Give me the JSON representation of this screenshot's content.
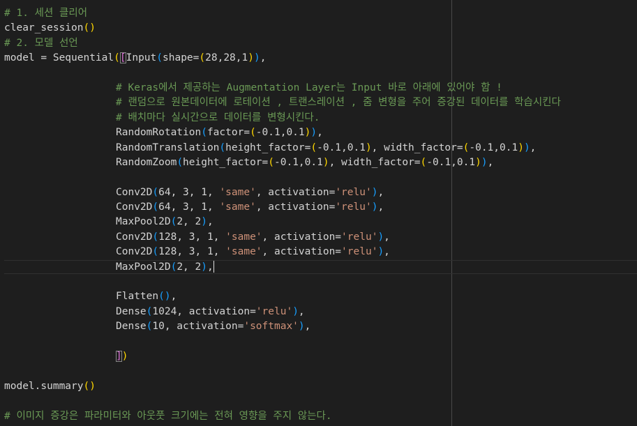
{
  "editor": {
    "theme_colors": {
      "background": "#1e1e1e",
      "text": "#d4d4d4",
      "comment": "#6a9955",
      "string": "#ce9178",
      "bracket_level_1": "#ffd700",
      "bracket_level_2": "#da70d6",
      "bracket_level_3": "#179fff"
    },
    "lines": [
      [
        {
          "t": "# 1. 세션 클리어",
          "k": "comment"
        }
      ],
      [
        {
          "t": "clear_session",
          "k": "default"
        },
        {
          "t": "()",
          "k": "b1"
        }
      ],
      [
        {
          "t": "# 2. 모델 선언",
          "k": "comment"
        }
      ],
      [
        {
          "t": "model = Sequential",
          "k": "default"
        },
        {
          "t": "(",
          "k": "b1"
        },
        {
          "t": "[",
          "k": "b2",
          "m": 1
        },
        {
          "t": "Input",
          "k": "default"
        },
        {
          "t": "(",
          "k": "b3"
        },
        {
          "t": "shape=",
          "k": "default"
        },
        {
          "t": "(",
          "k": "b1"
        },
        {
          "t": "28,28,1",
          "k": "default"
        },
        {
          "t": ")",
          "k": "b1"
        },
        {
          "t": ")",
          "k": "b3"
        },
        {
          "t": ",",
          "k": "default"
        }
      ],
      [],
      [
        {
          "t": "# Keras에서 제공하는 Augmentation Layer는 Input 바로 아래에 있어야 함 !",
          "k": "comment"
        }
      ],
      [
        {
          "t": "# 랜덤으로 원본데이터에 로테이션 , 트랜스레이션 , 줌 변형을 주어 증강된 데이터를 학습시킨다",
          "k": "comment"
        }
      ],
      [
        {
          "t": "# 배치마다 실시간으로 데이터를 변형시킨다.",
          "k": "comment"
        }
      ],
      [
        {
          "t": "RandomRotation",
          "k": "default"
        },
        {
          "t": "(",
          "k": "b3"
        },
        {
          "t": "factor=",
          "k": "default"
        },
        {
          "t": "(",
          "k": "b1"
        },
        {
          "t": "-0.1,0.1",
          "k": "default"
        },
        {
          "t": ")",
          "k": "b1"
        },
        {
          "t": ")",
          "k": "b3"
        },
        {
          "t": ",",
          "k": "default"
        }
      ],
      [
        {
          "t": "RandomTranslation",
          "k": "default"
        },
        {
          "t": "(",
          "k": "b3"
        },
        {
          "t": "height_factor=",
          "k": "default"
        },
        {
          "t": "(",
          "k": "b1"
        },
        {
          "t": "-0.1,0.1",
          "k": "default"
        },
        {
          "t": ")",
          "k": "b1"
        },
        {
          "t": ", width_factor=",
          "k": "default"
        },
        {
          "t": "(",
          "k": "b1"
        },
        {
          "t": "-0.1,0.1",
          "k": "default"
        },
        {
          "t": ")",
          "k": "b1"
        },
        {
          "t": ")",
          "k": "b3"
        },
        {
          "t": ",",
          "k": "default"
        }
      ],
      [
        {
          "t": "RandomZoom",
          "k": "default"
        },
        {
          "t": "(",
          "k": "b3"
        },
        {
          "t": "height_factor=",
          "k": "default"
        },
        {
          "t": "(",
          "k": "b1"
        },
        {
          "t": "-0.1,0.1",
          "k": "default"
        },
        {
          "t": ")",
          "k": "b1"
        },
        {
          "t": ", width_factor=",
          "k": "default"
        },
        {
          "t": "(",
          "k": "b1"
        },
        {
          "t": "-0.1,0.1",
          "k": "default"
        },
        {
          "t": ")",
          "k": "b1"
        },
        {
          "t": ")",
          "k": "b3"
        },
        {
          "t": ",",
          "k": "default"
        }
      ],
      [],
      [
        {
          "t": "Conv2D",
          "k": "default"
        },
        {
          "t": "(",
          "k": "b3"
        },
        {
          "t": "64, 3, 1, ",
          "k": "default"
        },
        {
          "t": "'same'",
          "k": "string"
        },
        {
          "t": ", activation=",
          "k": "default"
        },
        {
          "t": "'relu'",
          "k": "string"
        },
        {
          "t": ")",
          "k": "b3"
        },
        {
          "t": ",",
          "k": "default"
        }
      ],
      [
        {
          "t": "Conv2D",
          "k": "default"
        },
        {
          "t": "(",
          "k": "b3"
        },
        {
          "t": "64, 3, 1, ",
          "k": "default"
        },
        {
          "t": "'same'",
          "k": "string"
        },
        {
          "t": ", activation=",
          "k": "default"
        },
        {
          "t": "'relu'",
          "k": "string"
        },
        {
          "t": ")",
          "k": "b3"
        },
        {
          "t": ",",
          "k": "default"
        }
      ],
      [
        {
          "t": "MaxPool2D",
          "k": "default"
        },
        {
          "t": "(",
          "k": "b3"
        },
        {
          "t": "2, 2",
          "k": "default"
        },
        {
          "t": ")",
          "k": "b3"
        },
        {
          "t": ",",
          "k": "default"
        }
      ],
      [
        {
          "t": "Conv2D",
          "k": "default"
        },
        {
          "t": "(",
          "k": "b3"
        },
        {
          "t": "128, 3, 1, ",
          "k": "default"
        },
        {
          "t": "'same'",
          "k": "string"
        },
        {
          "t": ", activation=",
          "k": "default"
        },
        {
          "t": "'relu'",
          "k": "string"
        },
        {
          "t": ")",
          "k": "b3"
        },
        {
          "t": ",",
          "k": "default"
        }
      ],
      [
        {
          "t": "Conv2D",
          "k": "default"
        },
        {
          "t": "(",
          "k": "b3"
        },
        {
          "t": "128, 3, 1, ",
          "k": "default"
        },
        {
          "t": "'same'",
          "k": "string"
        },
        {
          "t": ", activation=",
          "k": "default"
        },
        {
          "t": "'relu'",
          "k": "string"
        },
        {
          "t": ")",
          "k": "b3"
        },
        {
          "t": ",",
          "k": "default"
        }
      ],
      [
        {
          "t": "MaxPool2D",
          "k": "default"
        },
        {
          "t": "(",
          "k": "b3"
        },
        {
          "t": "2, 2",
          "k": "default"
        },
        {
          "t": ")",
          "k": "b3"
        },
        {
          "t": ",",
          "k": "default"
        },
        {
          "cursor": true
        }
      ],
      [],
      [
        {
          "t": "Flatten",
          "k": "default"
        },
        {
          "t": "()",
          "k": "b3"
        },
        {
          "t": ",",
          "k": "default"
        }
      ],
      [
        {
          "t": "Dense",
          "k": "default"
        },
        {
          "t": "(",
          "k": "b3"
        },
        {
          "t": "1024, activation=",
          "k": "default"
        },
        {
          "t": "'relu'",
          "k": "string"
        },
        {
          "t": ")",
          "k": "b3"
        },
        {
          "t": ",",
          "k": "default"
        }
      ],
      [
        {
          "t": "Dense",
          "k": "default"
        },
        {
          "t": "(",
          "k": "b3"
        },
        {
          "t": "10, activation=",
          "k": "default"
        },
        {
          "t": "'softmax'",
          "k": "string"
        },
        {
          "t": ")",
          "k": "b3"
        },
        {
          "t": ",",
          "k": "default"
        }
      ],
      [],
      [
        {
          "t": "]",
          "k": "b2",
          "m": 1
        },
        {
          "t": ")",
          "k": "b1"
        }
      ],
      [],
      [
        {
          "t": "model.summary",
          "k": "default"
        },
        {
          "t": "()",
          "k": "b1"
        }
      ],
      [],
      [
        {
          "t": "# 이미지 증강은 파라미터와 아웃풋 크기에는 전혀 영향을 주지 않는다.",
          "k": "comment"
        }
      ]
    ],
    "indented_lines": [
      5,
      6,
      7,
      8,
      9,
      10,
      12,
      13,
      14,
      15,
      16,
      17,
      19,
      20,
      21,
      23
    ]
  }
}
